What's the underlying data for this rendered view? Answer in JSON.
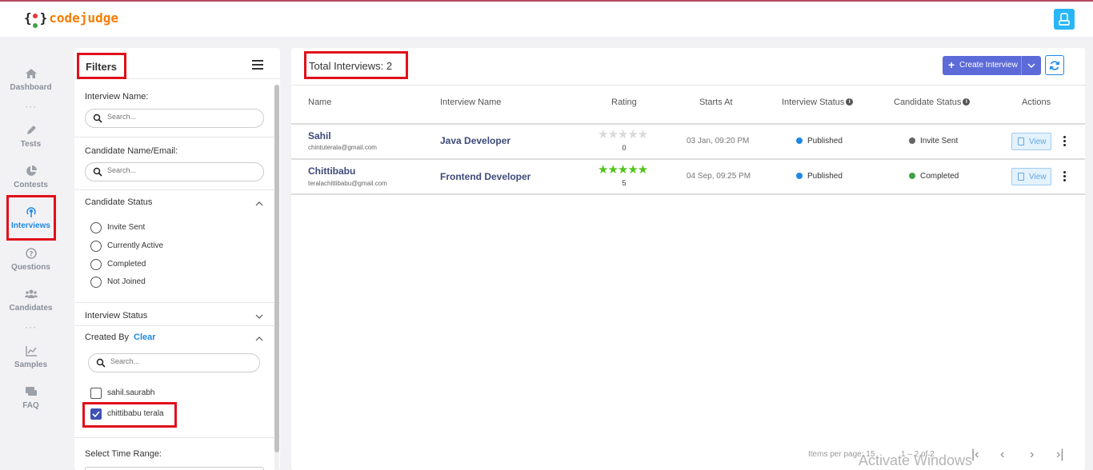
{
  "app": {
    "logo_open": "{",
    "logo_close": "}",
    "logo_word": "codejudge",
    "user_icon": "user-icon"
  },
  "nav": {
    "items": [
      {
        "label": "Dashboard",
        "icon": "home-icon"
      },
      {
        "label": "Tests",
        "icon": "pencil-icon"
      },
      {
        "label": "Contests",
        "icon": "pie-chart-icon"
      },
      {
        "label": "Interviews",
        "icon": "broadcast-icon",
        "active": true
      },
      {
        "label": "Questions",
        "icon": "question-circle-icon"
      },
      {
        "label": "Candidates",
        "icon": "users-icon"
      },
      {
        "label": "Samples",
        "icon": "line-chart-icon"
      },
      {
        "label": "FAQ",
        "icon": "chat-icon"
      }
    ],
    "dots": "···"
  },
  "filters": {
    "title": "Filters",
    "interview_name_label": "Interview Name:",
    "candidate_label": "Candidate Name/Email:",
    "search_placeholder": "Search...",
    "candidate_status": {
      "title": "Candidate Status",
      "options": [
        "Invite Sent",
        "Currently Active",
        "Completed",
        "Not Joined"
      ]
    },
    "interview_status_title": "Interview Status",
    "created_by": {
      "title": "Created By",
      "clear": "Clear",
      "options": [
        {
          "label": "sahil.saurabh",
          "checked": false
        },
        {
          "label": "chittibabu terala",
          "checked": true
        }
      ]
    },
    "time_range_label": "Select Time Range:"
  },
  "main": {
    "total": "Total Interviews: 2",
    "create_button": "Create Interview",
    "columns": [
      "Name",
      "Interview Name",
      "Rating",
      "Starts At",
      "Interview Status",
      "Candidate Status",
      "Actions"
    ],
    "rows": [
      {
        "name": "Sahil",
        "email": "chintuterala@gmail.com",
        "interview": "Java Developer",
        "rating": "0",
        "rating_value": 0,
        "starts_at": "03 Jan, 09:20 PM",
        "interview_status": "Published",
        "interview_status_color": "#1e88e5",
        "candidate_status": "Invite Sent",
        "candidate_status_color": "#666666",
        "action": "View"
      },
      {
        "name": "Chittibabu",
        "email": "teralachittibabu@gmail.com",
        "interview": "Frontend Developer",
        "rating": "5",
        "rating_value": 5,
        "starts_at": "04 Sep, 09:25 PM",
        "interview_status": "Published",
        "interview_status_color": "#1e88e5",
        "candidate_status": "Completed",
        "candidate_status_color": "#43a047",
        "action": "View"
      }
    ],
    "pager": {
      "items_per_page": "Items per page: 15",
      "range": "1 – 2 of 2"
    }
  },
  "watermark": "Activate Windows",
  "colors": {
    "accent": "#5c6bd8",
    "link": "#1e88e5",
    "highlight": "#e0101a",
    "star_on": "#52c41a",
    "star_off": "#d9d9d9"
  }
}
